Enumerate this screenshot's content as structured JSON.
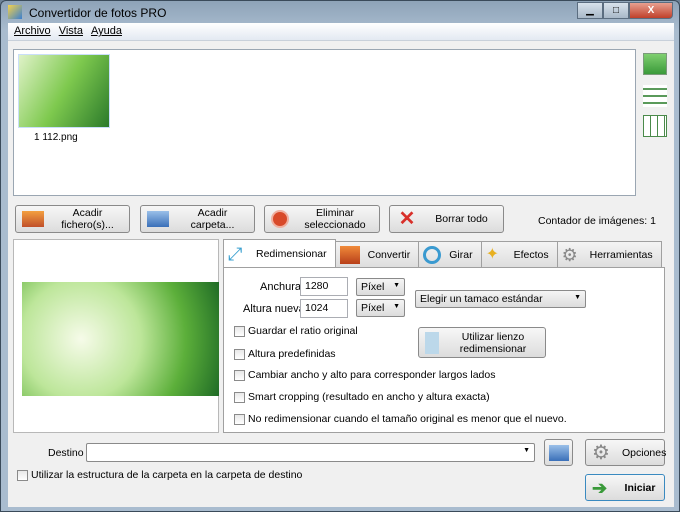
{
  "window": {
    "title": "Convertidor de fotos PRO",
    "minimize": "▁",
    "maximize": "□",
    "close": "X"
  },
  "menu": [
    "Archivo",
    "Vista",
    "Ayuda"
  ],
  "files": [
    {
      "name": "1 112.png"
    }
  ],
  "buttons": {
    "add_file": "Acadir fichero(s)...",
    "add_folder": "Acadir carpeta...",
    "remove_selected": "Eliminar seleccionado",
    "clear_all": "Borrar todo"
  },
  "counter": "Contador de imágenes: 1",
  "tabs": [
    "Redimensionar",
    "Convertir",
    "Girar",
    "Efectos",
    "Herramientas"
  ],
  "resize": {
    "width_label": "Anchura",
    "width": "1280",
    "width_unit": "Píxel",
    "height_label": "Altura nueva",
    "height": "1024",
    "height_unit": "Píxel",
    "standard_size": "Elegir un tamaco estándar",
    "canvas_btn_1": "Utilizar lienzo",
    "canvas_btn_2": "redimensionar",
    "options": [
      "Guardar el ratio original",
      "Altura predefinidas",
      "Cambiar ancho y alto para corresponder largos lados",
      "Smart cropping (resultado en ancho y altura exacta)",
      "No redimensionar cuando el tamaño original es menor que el nuevo."
    ]
  },
  "destination": {
    "label": "Destino",
    "value": "",
    "use_folder_structure": "Utilizar la estructura de la carpeta en la carpeta de destino"
  },
  "options_btn": "Opciones",
  "start_btn": "Iniciar"
}
